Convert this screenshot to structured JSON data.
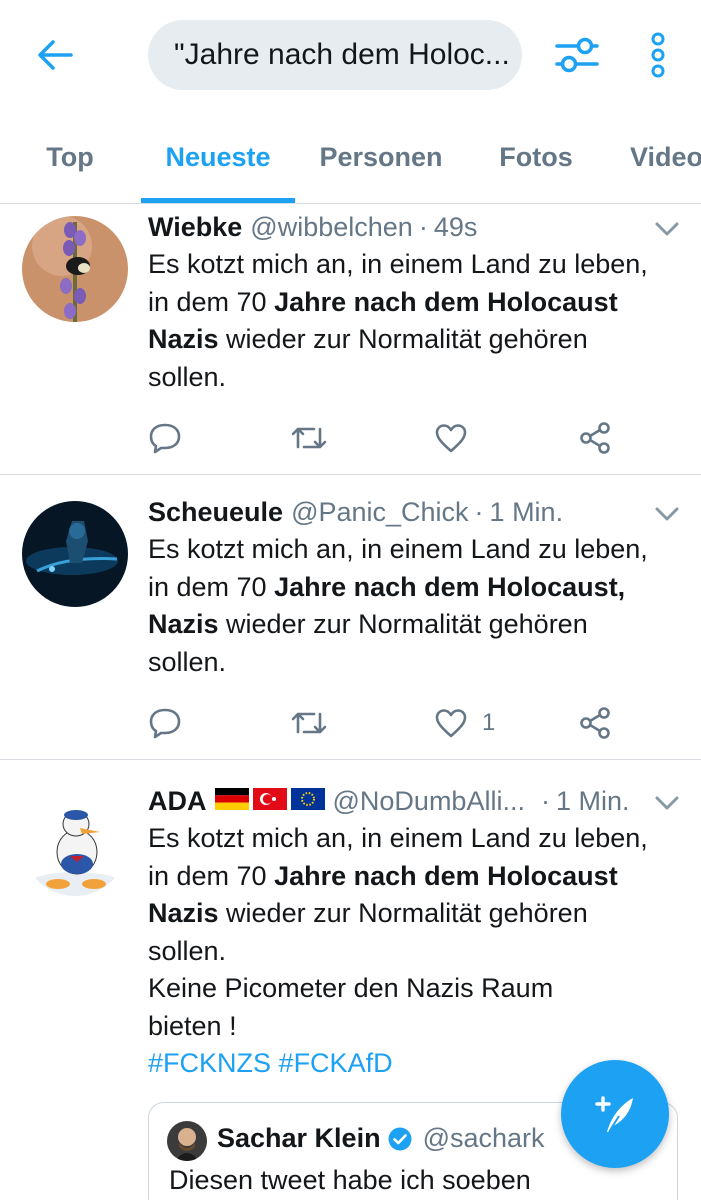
{
  "search": {
    "query": "\"Jahre nach dem Holoc..."
  },
  "tabs": [
    {
      "label": "Top"
    },
    {
      "label": "Neueste"
    },
    {
      "label": "Personen"
    },
    {
      "label": "Fotos"
    },
    {
      "label": "Video"
    }
  ],
  "active_tab": "Neueste",
  "colors": {
    "accent": "#1da1f2",
    "secondary_text": "#657786",
    "search_bg": "#e6ecf0"
  },
  "tweets": [
    {
      "name": "Wiebke",
      "handle": "@wibbelchen",
      "separator": "·",
      "time": "49s",
      "text": {
        "t1": "Es kotzt mich an, in einem Land zu leben,",
        "t2": "in dem 70 ",
        "t3": "Jahre nach dem Holocaust",
        "t4": "Nazis",
        "t5": " wieder zur Normalität gehören",
        "t6": "sollen."
      },
      "likes": ""
    },
    {
      "name": "Scheueule",
      "handle": "@Panic_Chick",
      "separator": "·",
      "time": "1 Min.",
      "text": {
        "t1": "Es kotzt mich an, in einem Land zu leben,",
        "t2": "in dem 70 ",
        "t3": "Jahre nach dem Holocaust,",
        "t4": "Nazis",
        "t5": " wieder zur Normalität gehören",
        "t6": "sollen."
      },
      "likes": "1"
    },
    {
      "name": "ADA",
      "handle": "@NoDumbAlli...",
      "separator": "·",
      "time": "1 Min.",
      "text": {
        "t1": "Es kotzt mich an, in einem Land zu leben,",
        "t2": "in dem 70 ",
        "t3": "Jahre nach dem Holocaust",
        "t4": "Nazis",
        "t5": " wieder zur Normalität gehören",
        "t6": "sollen.",
        "t7": "Keine Picometer den Nazis Raum",
        "t8": "bieten !",
        "hashtag1": "#FCKNZS",
        "hashtag2": "#FCKAfD"
      },
      "quote": {
        "name": "Sachar Klein",
        "handle": "@sachark",
        "text": "Diesen tweet habe ich soeben"
      }
    }
  ]
}
